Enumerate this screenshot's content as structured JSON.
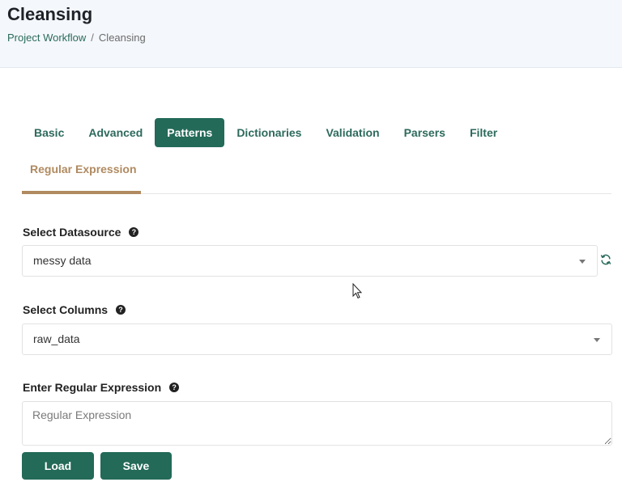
{
  "header": {
    "title": "Cleansing",
    "breadcrumb": {
      "parent": "Project Workflow",
      "separator": "/",
      "current": "Cleansing"
    }
  },
  "tabs": [
    {
      "label": "Basic",
      "active": false
    },
    {
      "label": "Advanced",
      "active": false
    },
    {
      "label": "Patterns",
      "active": true
    },
    {
      "label": "Dictionaries",
      "active": false
    },
    {
      "label": "Validation",
      "active": false
    },
    {
      "label": "Parsers",
      "active": false
    },
    {
      "label": "Filter",
      "active": false
    }
  ],
  "subtabs": [
    {
      "label": "Regular Expression",
      "active": true
    }
  ],
  "form": {
    "datasource": {
      "label": "Select Datasource",
      "value": "messy data",
      "help": "?"
    },
    "columns": {
      "label": "Select Columns",
      "value": "raw_data",
      "help": "?"
    },
    "regex": {
      "label": "Enter Regular Expression",
      "placeholder": "Regular Expression",
      "help": "?"
    }
  },
  "buttons": {
    "load": "Load",
    "save": "Save"
  },
  "colors": {
    "primary": "#236a58",
    "accent": "#b08a60",
    "header_bg": "#f4f7fb"
  }
}
